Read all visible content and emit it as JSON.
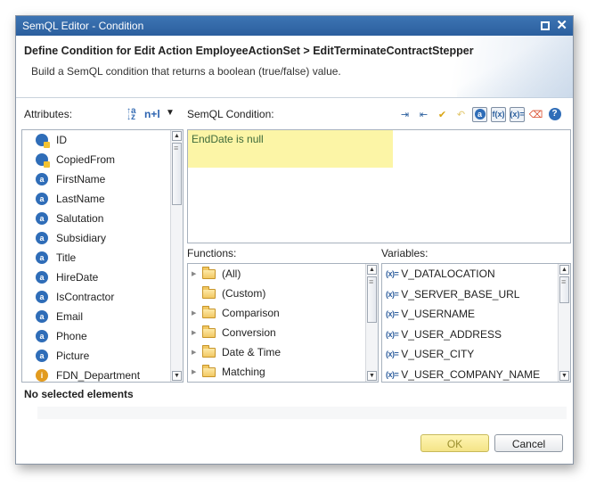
{
  "window": {
    "title": "SemQL Editor - Condition"
  },
  "header": {
    "title": "Define Condition for Edit Action EmployeeActionSet > EditTerminateContractStepper",
    "subtitle": "Build a SemQL condition that returns a boolean (true/false) value."
  },
  "attributes": {
    "label": "Attributes:",
    "toggle_label": "n+l",
    "items": [
      {
        "label": "ID",
        "icon": "reference-attribute-icon"
      },
      {
        "label": "CopiedFrom",
        "icon": "reference-attribute-icon"
      },
      {
        "label": "FirstName",
        "icon": "attribute-icon"
      },
      {
        "label": "LastName",
        "icon": "attribute-icon"
      },
      {
        "label": "Salutation",
        "icon": "attribute-icon"
      },
      {
        "label": "Subsidiary",
        "icon": "attribute-icon"
      },
      {
        "label": "Title",
        "icon": "attribute-icon"
      },
      {
        "label": "HireDate",
        "icon": "attribute-icon"
      },
      {
        "label": "IsContractor",
        "icon": "attribute-icon"
      },
      {
        "label": "Email",
        "icon": "attribute-icon"
      },
      {
        "label": "Phone",
        "icon": "attribute-icon"
      },
      {
        "label": "Picture",
        "icon": "attribute-icon"
      },
      {
        "label": "FDN_Department",
        "icon": "relationship-icon"
      }
    ]
  },
  "condition": {
    "label": "SemQL Condition:",
    "value": "EndDate is null"
  },
  "toolbar": {
    "buttons": [
      "indent-icon",
      "outdent-icon",
      "validate-icon",
      "undo-icon",
      "attribute-toggle-icon",
      "functions-toggle-icon",
      "variables-toggle-icon",
      "clear-icon",
      "help-icon"
    ],
    "fx_label": "f(x)",
    "var_label": "(x)=",
    "help_label": "?",
    "attr_label": "a"
  },
  "functions": {
    "label": "Functions:",
    "items": [
      {
        "label": "(All)",
        "expandable": true
      },
      {
        "label": "(Custom)",
        "expandable": false
      },
      {
        "label": "Comparison",
        "expandable": true
      },
      {
        "label": "Conversion",
        "expandable": true
      },
      {
        "label": "Date & Time",
        "expandable": true
      },
      {
        "label": "Matching",
        "expandable": true
      }
    ]
  },
  "variables": {
    "label": "Variables:",
    "prefix": "(x)=",
    "items": [
      "V_DATALOCATION",
      "V_SERVER_BASE_URL",
      "V_USERNAME",
      "V_USER_ADDRESS",
      "V_USER_CITY",
      "V_USER_COMPANY_NAME"
    ]
  },
  "selection": {
    "status": "No selected elements"
  },
  "buttons": {
    "ok": "OK",
    "cancel": "Cancel"
  },
  "colors": {
    "titlebar": "#2b5f9e",
    "condition_highlight": "#fcf5a6",
    "ok_button": "#f4e487"
  }
}
